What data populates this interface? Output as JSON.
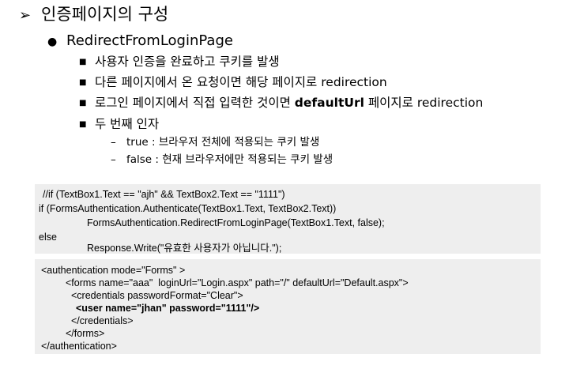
{
  "heading": "인증페이지의 구성",
  "subheading": "RedirectFromLoginPage",
  "bullets": [
    "사용자 인증을 완료하고 쿠키를 발생",
    "다른 페이지에서 온 요청이면 해당 페이지로 redirection",
    "로그인 페이지에서 직접 입력한 것이면 defaultUrl 페이지로 redirection",
    "두 번째 인자"
  ],
  "bullet_bold_tokens": {
    "b1": "redirection",
    "b2a": "defaultUrl",
    "b2b": "redirection"
  },
  "bullet_parts": {
    "b1_pre": "다른 페이지에서 온 요청이면 해당 페이지로 ",
    "b2_pre": "로그인 페이지에서 직접 입력한 것이면 ",
    "b2_mid": " 페이지로 "
  },
  "sub_bullets": [
    "true : 브라우저 전체에 적용되는 쿠키 발생",
    "false : 현재 브라우저에만 적용되는 쿠키 발생"
  ],
  "code_block_1": [
    "//if (TextBox1.Text == \"ajh\" && TextBox2.Text == \"1111\")",
    "if (FormsAuthentication.Authenticate(TextBox1.Text, TextBox2.Text))",
    "FormsAuthentication.RedirectFromLoginPage(TextBox1.Text, false);",
    "else",
    "Response.Write(\"유효한 사용자가 아닙니다.\");"
  ],
  "code_block_2": [
    "<authentication mode=\"Forms\" >",
    "<forms name=\"aaa\"  loginUrl=\"Login.aspx\" path=\"/\" defaultUrl=\"Default.aspx\">",
    "<credentials passwordFormat=\"Clear\">",
    "<user name=\"jhan\" password=\"1111\"/>",
    "</credentials>",
    "</forms>",
    "</authentication>"
  ]
}
